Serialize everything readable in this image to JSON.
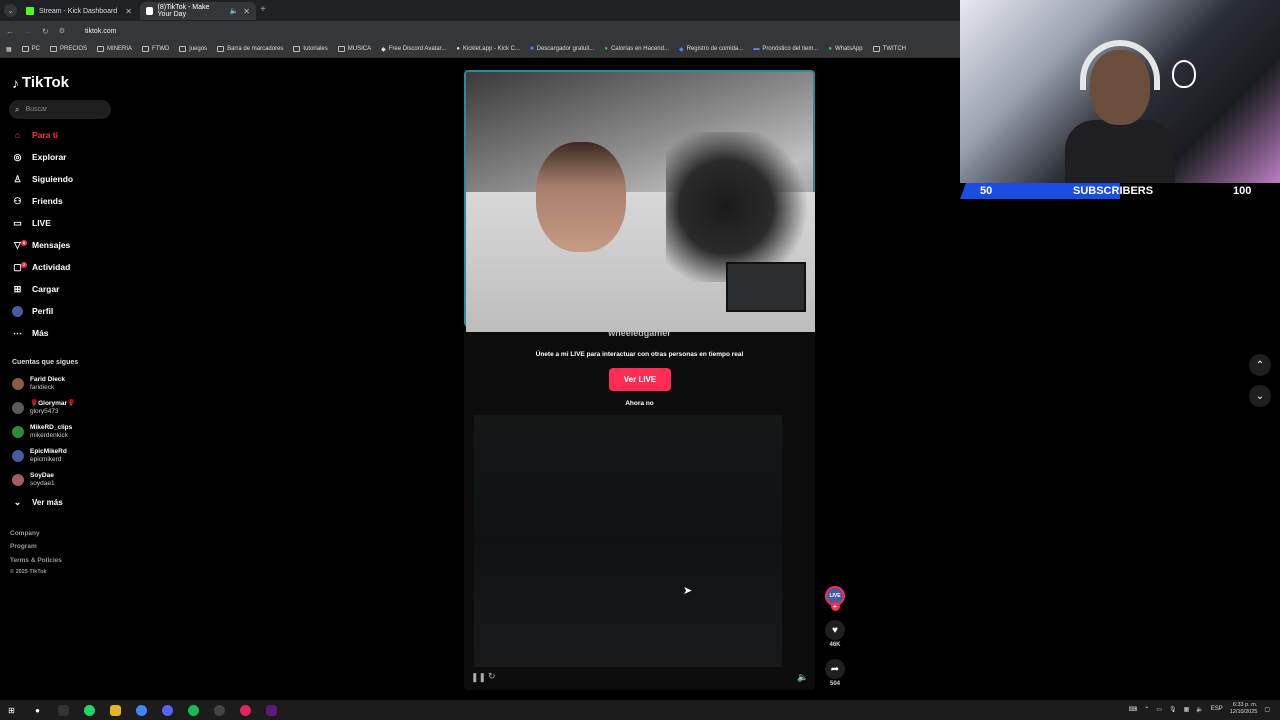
{
  "browser": {
    "tabs": [
      {
        "label": "Stream - Kick Dashboard",
        "close": "✕"
      },
      {
        "label": "(8)TikTok - Make Your Day",
        "close": "✕"
      }
    ],
    "new_tab": "+",
    "url": "tiktok.com",
    "bookmarks": [
      "PC",
      "PRECIOS",
      "MINERIA",
      "FTWD",
      "juegos",
      "Barra de marcadores",
      "tutoriales",
      "MUSICA",
      "Free Discord Avatar...",
      "Kicklet.app - Kick C...",
      "Descargador gratuit...",
      "Calorías en Hacend...",
      "Registro de comida...",
      "Pronóstico del tiem...",
      "WhatsApp",
      "TWITCH"
    ]
  },
  "sidebar": {
    "logo": "TikTok",
    "search_placeholder": "Buscar",
    "nav": [
      {
        "label": "Para ti",
        "icon": "home-icon"
      },
      {
        "label": "Explorar",
        "icon": "compass-icon"
      },
      {
        "label": "Siguiendo",
        "icon": "following-icon"
      },
      {
        "label": "Friends",
        "icon": "friends-icon"
      },
      {
        "label": "LIVE",
        "icon": "live-icon"
      },
      {
        "label": "Mensajes",
        "icon": "messages-icon",
        "badge": "8"
      },
      {
        "label": "Actividad",
        "icon": "activity-icon",
        "badge": "2"
      },
      {
        "label": "Cargar",
        "icon": "upload-icon"
      },
      {
        "label": "Perfil",
        "icon": "profile-icon"
      },
      {
        "label": "Más",
        "icon": "more-icon"
      }
    ],
    "following_title": "Cuentas que sigues",
    "following": [
      {
        "name": "Farid Dieck",
        "handle": "faridieck",
        "color": "#8a5a44"
      },
      {
        "name": "🌹Glorymar🌹",
        "handle": "glory5473",
        "color": "#5a5a5a"
      },
      {
        "name": "MikeRD_clips",
        "handle": "mikerdenkick",
        "color": "#2f8a3a"
      },
      {
        "name": "EpicMikeRd",
        "handle": "epicmikerd",
        "color": "#4a5aa0"
      },
      {
        "name": "SoyDae",
        "handle": "soydae1",
        "color": "#a06060"
      }
    ],
    "see_more": "Ver más",
    "footer": [
      "Company",
      "Program",
      "Terms & Policies",
      "© 2025 TikTok"
    ]
  },
  "video": {
    "channel": "wheeledgamer",
    "overlay_text": "Únete a mi LIVE para interactuar con otras personas en tiempo real",
    "ver_live": "Ver LIVE",
    "ahora_no": "Ahora no",
    "likes": "46K",
    "shares": "504",
    "live_badge": "LIVE"
  },
  "stream_overlay": {
    "sub_current": "50",
    "sub_label": "SUBSCRIBERS",
    "sub_goal": "100",
    "progress": 0.5,
    "accent": "#1b4de0"
  },
  "taskbar": {
    "lang": "ESP",
    "time": "6:33 p. m.",
    "date": "12/10/2025"
  }
}
